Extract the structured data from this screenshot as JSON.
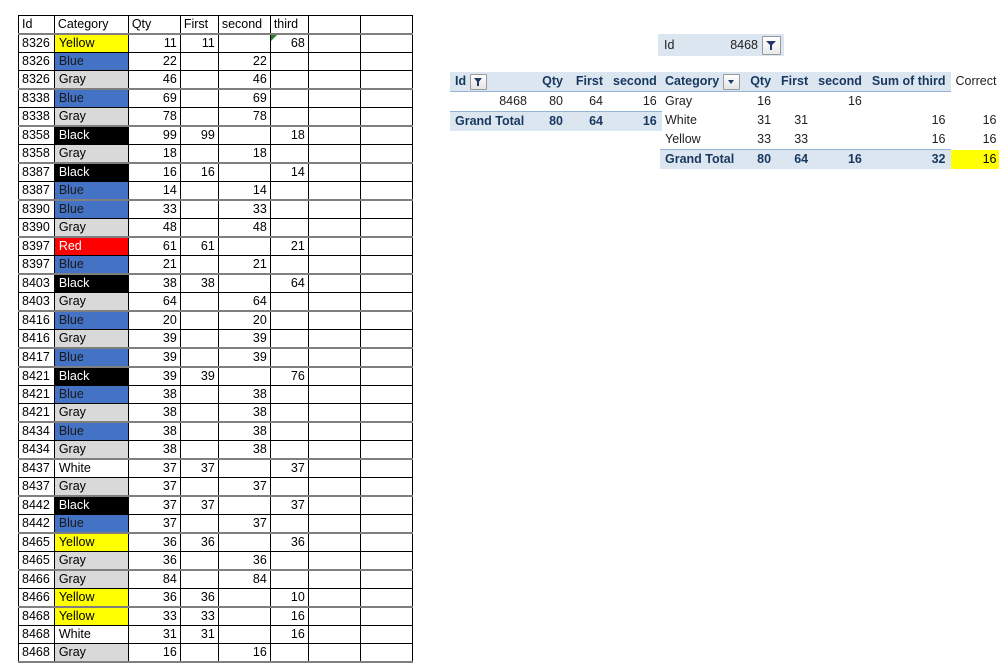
{
  "main_grid": {
    "headers": [
      "Id",
      "Category",
      "Qty",
      "First",
      "second",
      "third",
      "",
      ""
    ],
    "rows": [
      {
        "id": "8326",
        "category": "Yellow",
        "qty": "11",
        "first": "11",
        "second": "",
        "third": "68",
        "group_start": true,
        "flag": true
      },
      {
        "id": "8326",
        "category": "Blue",
        "qty": "22",
        "first": "",
        "second": "22",
        "third": "",
        "group_start": false,
        "flag": false
      },
      {
        "id": "8326",
        "category": "Gray",
        "qty": "46",
        "first": "",
        "second": "46",
        "third": "",
        "group_start": false,
        "flag": false
      },
      {
        "id": "8338",
        "category": "Blue",
        "qty": "69",
        "first": "",
        "second": "69",
        "third": "",
        "group_start": true,
        "flag": false
      },
      {
        "id": "8338",
        "category": "Gray",
        "qty": "78",
        "first": "",
        "second": "78",
        "third": "",
        "group_start": false,
        "flag": false
      },
      {
        "id": "8358",
        "category": "Black",
        "qty": "99",
        "first": "99",
        "second": "",
        "third": "18",
        "group_start": true,
        "flag": false
      },
      {
        "id": "8358",
        "category": "Gray",
        "qty": "18",
        "first": "",
        "second": "18",
        "third": "",
        "group_start": false,
        "flag": false
      },
      {
        "id": "8387",
        "category": "Black",
        "qty": "16",
        "first": "16",
        "second": "",
        "third": "14",
        "group_start": true,
        "flag": false
      },
      {
        "id": "8387",
        "category": "Blue",
        "qty": "14",
        "first": "",
        "second": "14",
        "third": "",
        "group_start": false,
        "flag": false
      },
      {
        "id": "8390",
        "category": "Blue",
        "qty": "33",
        "first": "",
        "second": "33",
        "third": "",
        "group_start": true,
        "flag": false
      },
      {
        "id": "8390",
        "category": "Gray",
        "qty": "48",
        "first": "",
        "second": "48",
        "third": "",
        "group_start": false,
        "flag": false
      },
      {
        "id": "8397",
        "category": "Red",
        "qty": "61",
        "first": "61",
        "second": "",
        "third": "21",
        "group_start": true,
        "flag": false
      },
      {
        "id": "8397",
        "category": "Blue",
        "qty": "21",
        "first": "",
        "second": "21",
        "third": "",
        "group_start": false,
        "flag": false
      },
      {
        "id": "8403",
        "category": "Black",
        "qty": "38",
        "first": "38",
        "second": "",
        "third": "64",
        "group_start": true,
        "flag": false
      },
      {
        "id": "8403",
        "category": "Gray",
        "qty": "64",
        "first": "",
        "second": "64",
        "third": "",
        "group_start": false,
        "flag": false
      },
      {
        "id": "8416",
        "category": "Blue",
        "qty": "20",
        "first": "",
        "second": "20",
        "third": "",
        "group_start": true,
        "flag": false
      },
      {
        "id": "8416",
        "category": "Gray",
        "qty": "39",
        "first": "",
        "second": "39",
        "third": "",
        "group_start": false,
        "flag": false
      },
      {
        "id": "8417",
        "category": "Blue",
        "qty": "39",
        "first": "",
        "second": "39",
        "third": "",
        "group_start": true,
        "flag": false
      },
      {
        "id": "8421",
        "category": "Black",
        "qty": "39",
        "first": "39",
        "second": "",
        "third": "76",
        "group_start": true,
        "flag": false
      },
      {
        "id": "8421",
        "category": "Blue",
        "qty": "38",
        "first": "",
        "second": "38",
        "third": "",
        "group_start": false,
        "flag": false
      },
      {
        "id": "8421",
        "category": "Gray",
        "qty": "38",
        "first": "",
        "second": "38",
        "third": "",
        "group_start": false,
        "flag": false
      },
      {
        "id": "8434",
        "category": "Blue",
        "qty": "38",
        "first": "",
        "second": "38",
        "third": "",
        "group_start": true,
        "flag": false
      },
      {
        "id": "8434",
        "category": "Gray",
        "qty": "38",
        "first": "",
        "second": "38",
        "third": "",
        "group_start": false,
        "flag": false
      },
      {
        "id": "8437",
        "category": "White",
        "qty": "37",
        "first": "37",
        "second": "",
        "third": "37",
        "group_start": true,
        "flag": false
      },
      {
        "id": "8437",
        "category": "Gray",
        "qty": "37",
        "first": "",
        "second": "37",
        "third": "",
        "group_start": false,
        "flag": false
      },
      {
        "id": "8442",
        "category": "Black",
        "qty": "37",
        "first": "37",
        "second": "",
        "third": "37",
        "group_start": true,
        "flag": false
      },
      {
        "id": "8442",
        "category": "Blue",
        "qty": "37",
        "first": "",
        "second": "37",
        "third": "",
        "group_start": false,
        "flag": false
      },
      {
        "id": "8465",
        "category": "Yellow",
        "qty": "36",
        "first": "36",
        "second": "",
        "third": "36",
        "group_start": true,
        "flag": false
      },
      {
        "id": "8465",
        "category": "Gray",
        "qty": "36",
        "first": "",
        "second": "36",
        "third": "",
        "group_start": false,
        "flag": false
      },
      {
        "id": "8466",
        "category": "Gray",
        "qty": "84",
        "first": "",
        "second": "84",
        "third": "",
        "group_start": true,
        "flag": false
      },
      {
        "id": "8466",
        "category": "Yellow",
        "qty": "36",
        "first": "36",
        "second": "",
        "third": "10",
        "group_start": false,
        "flag": false
      },
      {
        "id": "8468",
        "category": "Yellow",
        "qty": "33",
        "first": "33",
        "second": "",
        "third": "16",
        "group_start": true,
        "flag": false
      },
      {
        "id": "8468",
        "category": "White",
        "qty": "31",
        "first": "31",
        "second": "",
        "third": "16",
        "group_start": false,
        "flag": false
      },
      {
        "id": "8468",
        "category": "Gray",
        "qty": "16",
        "first": "",
        "second": "16",
        "third": "",
        "group_start": false,
        "flag": false
      }
    ]
  },
  "report_filter": {
    "label": "Id",
    "value": "8468",
    "button_icon": "filter-funnel-icon"
  },
  "pivot_id": {
    "headers": [
      "Id",
      "Qty",
      "First",
      "second"
    ],
    "header_icon": "filter-funnel-icon",
    "rows": [
      {
        "label": "8468",
        "qty": "80",
        "first": "64",
        "second": "16"
      }
    ],
    "total": {
      "label": "Grand Total",
      "qty": "80",
      "first": "64",
      "second": "16"
    }
  },
  "pivot_category": {
    "headers": [
      "Category",
      "Qty",
      "First",
      "second",
      "Sum of third",
      "Correct"
    ],
    "header_icon": "chevron-down-icon",
    "rows": [
      {
        "label": "Gray",
        "qty": "16",
        "first": "",
        "second": "16",
        "third": "",
        "correct": ""
      },
      {
        "label": "White",
        "qty": "31",
        "first": "31",
        "second": "",
        "third": "16",
        "correct": "16"
      },
      {
        "label": "Yellow",
        "qty": "33",
        "first": "33",
        "second": "",
        "third": "16",
        "correct": "16"
      }
    ],
    "total": {
      "label": "Grand Total",
      "qty": "80",
      "first": "64",
      "second": "16",
      "third": "32",
      "correct": "16"
    }
  },
  "colors": {
    "yellow": "#ffff00",
    "blue": "#4472c4",
    "gray": "#d9d9d9",
    "black": "#000000",
    "red": "#ff0000",
    "white": "#ffffff",
    "pivot_header": "#dce6f1",
    "pivot_header_text": "#17375e",
    "error_flag": "#2e7d32"
  }
}
